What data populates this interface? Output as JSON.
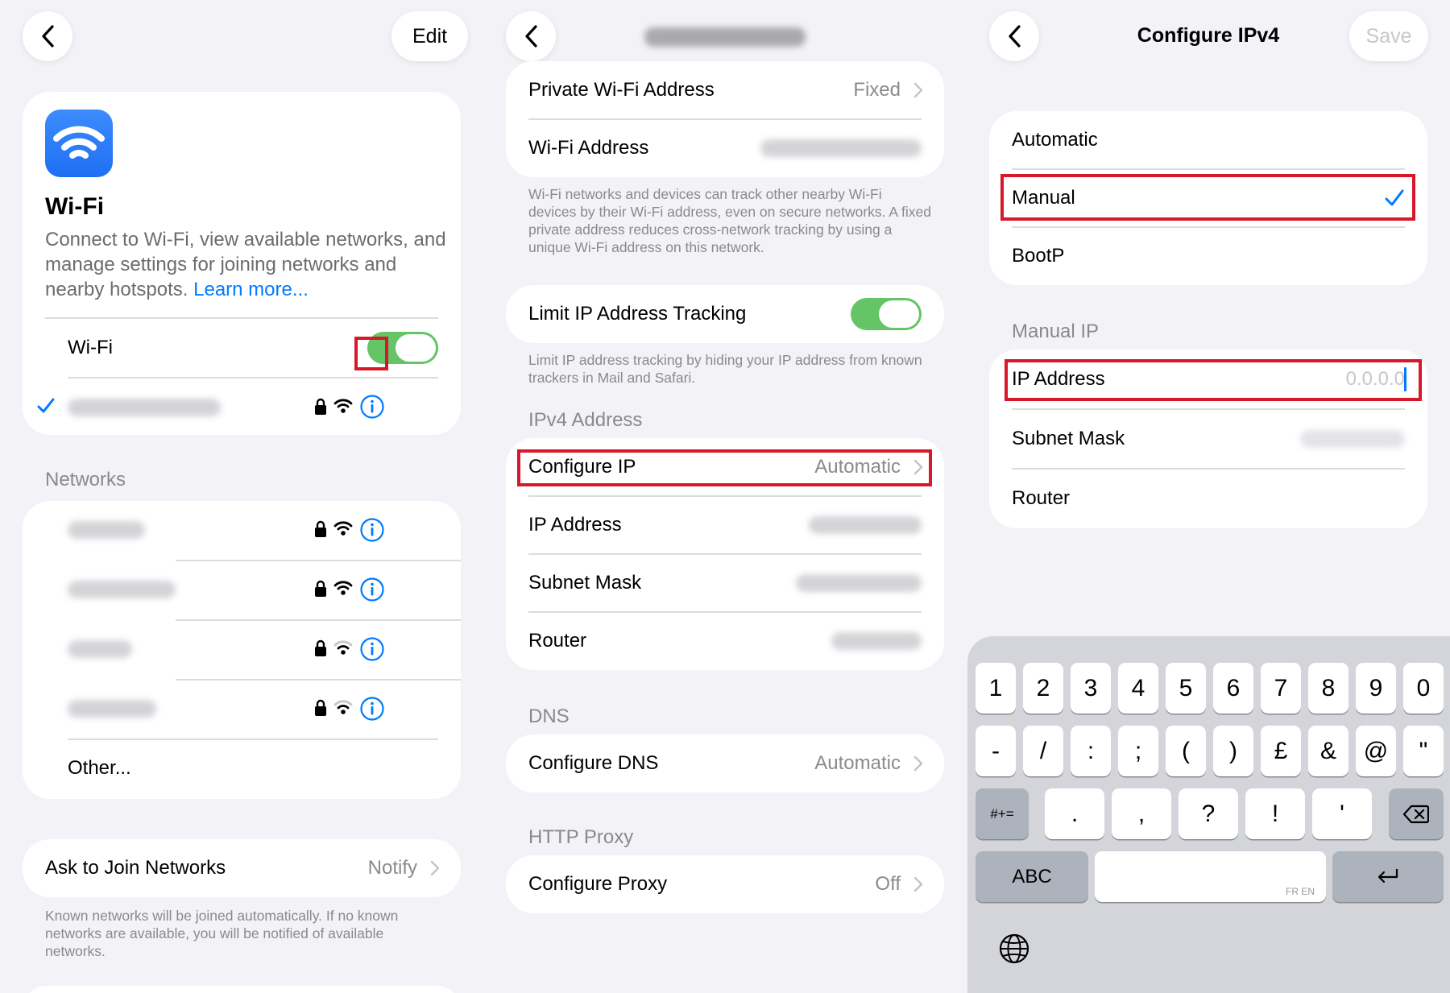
{
  "panel1": {
    "edit_label": "Edit",
    "wifi_title": "Wi-Fi",
    "description": "Connect to Wi-Fi, view available networks, and manage settings for joining networks and nearby hotspots.",
    "learn_more": "Learn more...",
    "wifi_toggle_label": "Wi-Fi",
    "networks_header": "Networks",
    "other_label": "Other...",
    "ask_join_label": "Ask to Join Networks",
    "ask_join_value": "Notify",
    "ask_join_footnote": "Known networks will be joined automatically. If no known networks are available, you will be notified of available networks."
  },
  "panel2": {
    "private_addr_label": "Private Wi-Fi Address",
    "private_addr_value": "Fixed",
    "wifi_address_label": "Wi-Fi Address",
    "private_footnote": "Wi-Fi networks and devices can track other nearby Wi-Fi devices by their Wi-Fi address, even on secure networks. A fixed private address reduces cross-network tracking by using a unique Wi-Fi address on this network.",
    "limit_ip_label": "Limit IP Address Tracking",
    "limit_ip_footnote": "Limit IP address tracking by hiding your IP address from known trackers in Mail and Safari.",
    "ipv4_header": "IPv4 Address",
    "configure_ip_label": "Configure IP",
    "configure_ip_value": "Automatic",
    "ip_address_label": "IP Address",
    "subnet_label": "Subnet Mask",
    "router_label": "Router",
    "dns_header": "DNS",
    "configure_dns_label": "Configure DNS",
    "configure_dns_value": "Automatic",
    "proxy_header": "HTTP Proxy",
    "configure_proxy_label": "Configure Proxy",
    "configure_proxy_value": "Off"
  },
  "panel3": {
    "title": "Configure IPv4",
    "save_label": "Save",
    "options": [
      "Automatic",
      "Manual",
      "BootP"
    ],
    "manual_header": "Manual IP",
    "ip_address_label": "IP Address",
    "ip_address_placeholder": "0.0.0.0",
    "subnet_label": "Subnet Mask",
    "router_label": "Router"
  },
  "keyboard": {
    "row1": [
      "1",
      "2",
      "3",
      "4",
      "5",
      "6",
      "7",
      "8",
      "9",
      "0"
    ],
    "row2": [
      "-",
      "/",
      ":",
      ";",
      "(",
      ")",
      "£",
      "&",
      "@",
      "\""
    ],
    "row3_left": "#+=",
    "row3": [
      ".",
      ",",
      "?",
      "!",
      "'"
    ],
    "abc": "ABC",
    "space_hint": "FR EN"
  },
  "colors": {
    "accent": "#007aff",
    "toggle_on": "#65c466",
    "highlight": "#d7182a"
  }
}
